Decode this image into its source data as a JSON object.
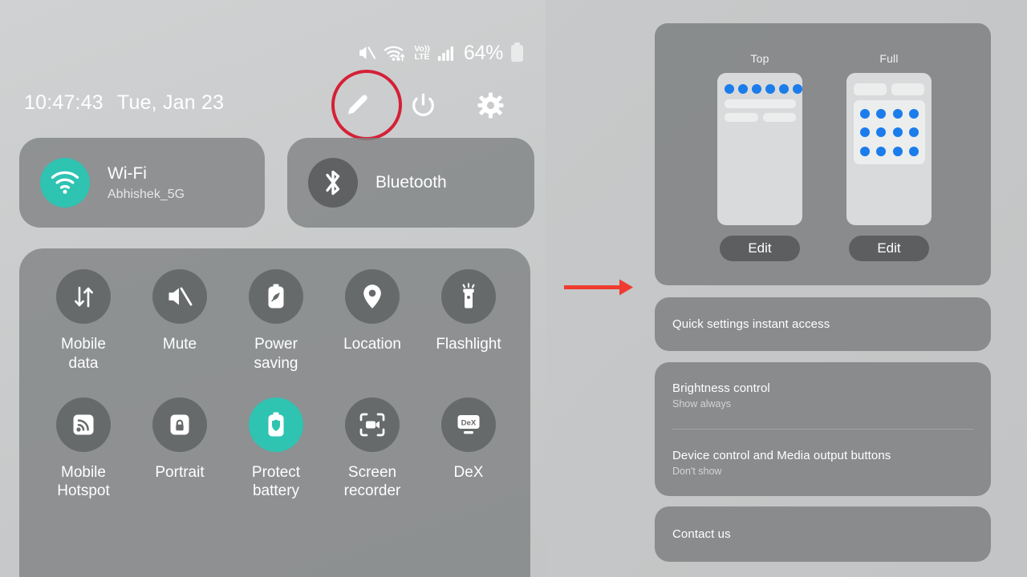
{
  "phone": {
    "status_bar": {
      "icons": [
        "mute-icon",
        "wifi-transfer-icon",
        "volte-icon",
        "signal-bars-icon"
      ],
      "volte_top": "Vo))",
      "volte_bottom": "LTE",
      "battery_percent": "64%"
    },
    "clock": {
      "time": "10:47:43",
      "date": "Tue, Jan 23"
    },
    "header_actions": [
      {
        "name": "edit-button",
        "icon": "pencil-icon",
        "highlighted": true
      },
      {
        "name": "power-button",
        "icon": "power-icon",
        "highlighted": false
      },
      {
        "name": "settings-button",
        "icon": "gear-icon",
        "highlighted": false
      }
    ],
    "connectivity": [
      {
        "title": "Wi-Fi",
        "subtitle": "Abhishek_5G",
        "icon": "wifi-icon",
        "active": true
      },
      {
        "title": "Bluetooth",
        "subtitle": "",
        "icon": "bluetooth-icon",
        "active": false
      }
    ],
    "toggles": [
      {
        "label": "Mobile\ndata",
        "icon": "mobile-data-icon",
        "active": false
      },
      {
        "label": "Mute",
        "icon": "mute-icon",
        "active": false
      },
      {
        "label": "Power\nsaving",
        "icon": "power-saving-icon",
        "active": false
      },
      {
        "label": "Location",
        "icon": "location-pin-icon",
        "active": false
      },
      {
        "label": "Flashlight",
        "icon": "flashlight-icon",
        "active": false
      },
      {
        "label": "Mobile\nHotspot",
        "icon": "hotspot-icon",
        "active": false
      },
      {
        "label": "Portrait",
        "icon": "rotation-lock-icon",
        "active": false
      },
      {
        "label": "Protect\nbattery",
        "icon": "protect-battery-icon",
        "active": true
      },
      {
        "label": "Screen\nrecorder",
        "icon": "screen-recorder-icon",
        "active": false
      },
      {
        "label": "DeX",
        "icon": "dex-icon",
        "active": false
      }
    ]
  },
  "settings": {
    "layout_card": {
      "options": [
        {
          "label": "Top",
          "edit_label": "Edit",
          "dots": 6
        },
        {
          "label": "Full",
          "edit_label": "Edit",
          "grid_dots": 12
        }
      ]
    },
    "rows": [
      {
        "title": "Quick settings instant access",
        "subtitle": ""
      },
      {
        "title": "Brightness control",
        "subtitle": "Show always"
      },
      {
        "title": "Device control and Media output buttons",
        "subtitle": "Don't show"
      },
      {
        "title": "Contact us",
        "subtitle": ""
      }
    ]
  },
  "annotations": {
    "highlight_circle_color": "#d52036",
    "arrow_color": "#ef3b30",
    "arrow_name": "flow-arrow"
  },
  "colors": {
    "accent_teal": "#2fc3b2",
    "preview_blue": "#1b7ceb",
    "panel_gray": "#818384",
    "background": "#c8cacb"
  }
}
